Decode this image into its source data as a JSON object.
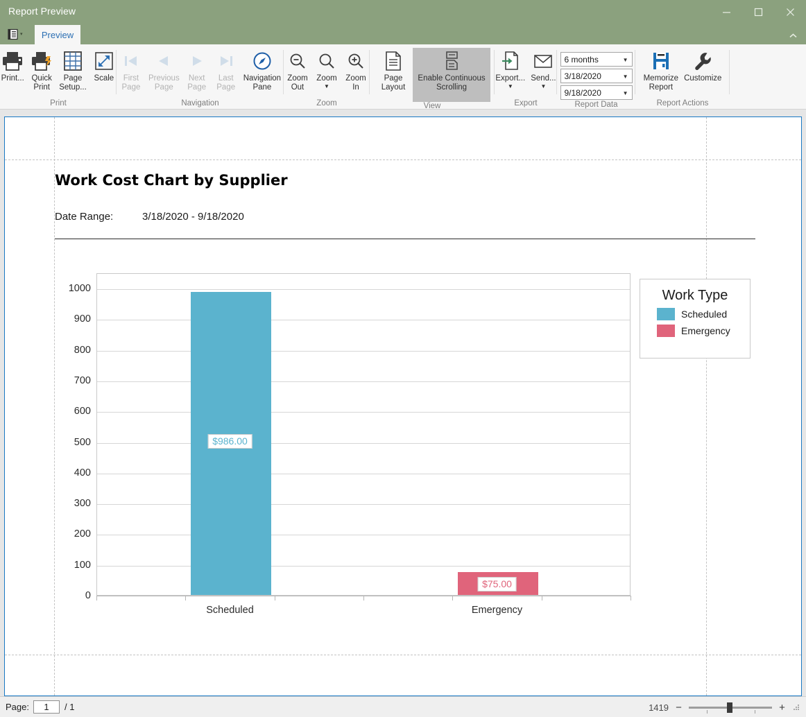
{
  "window": {
    "title": "Report Preview",
    "minimize_label": "Minimize",
    "maximize_label": "Maximize",
    "close_label": "Close"
  },
  "tabs": {
    "quick_access_icon": "report-icon",
    "items": [
      {
        "label": "Preview",
        "active": true
      }
    ],
    "collapse_icon": "chevron-up-icon"
  },
  "ribbon": {
    "groups": [
      {
        "name": "Print",
        "label": "Print",
        "buttons": [
          {
            "name": "print",
            "label": "Print...",
            "icon": "printer-icon",
            "disabled": false,
            "caret": false
          },
          {
            "name": "quick-print",
            "label": "Quick\nPrint",
            "icon": "quick-printer-icon",
            "disabled": false,
            "caret": false
          },
          {
            "name": "page-setup",
            "label": "Page\nSetup...",
            "icon": "page-setup-icon",
            "disabled": false,
            "caret": false
          },
          {
            "name": "scale",
            "label": "Scale",
            "icon": "scale-icon",
            "disabled": false,
            "caret": false
          }
        ]
      },
      {
        "name": "Navigation",
        "label": "Navigation",
        "buttons": [
          {
            "name": "first-page",
            "label": "First\nPage",
            "icon": "first-page-icon",
            "disabled": true,
            "caret": false
          },
          {
            "name": "previous-page",
            "label": "Previous\nPage",
            "icon": "previous-page-icon",
            "disabled": true,
            "caret": false
          },
          {
            "name": "next-page",
            "label": "Next\nPage",
            "icon": "next-page-icon",
            "disabled": true,
            "caret": false
          },
          {
            "name": "last-page",
            "label": "Last\nPage",
            "icon": "last-page-icon",
            "disabled": true,
            "caret": false
          },
          {
            "name": "navigation-pane",
            "label": "Navigation\nPane",
            "icon": "compass-icon",
            "disabled": false,
            "caret": false
          }
        ]
      },
      {
        "name": "Zoom",
        "label": "Zoom",
        "buttons": [
          {
            "name": "zoom-out",
            "label": "Zoom\nOut",
            "icon": "zoom-out-icon",
            "disabled": false,
            "caret": false
          },
          {
            "name": "zoom",
            "label": "Zoom",
            "icon": "magnifier-icon",
            "disabled": false,
            "caret": true
          },
          {
            "name": "zoom-in",
            "label": "Zoom\nIn",
            "icon": "zoom-in-icon",
            "disabled": false,
            "caret": false
          }
        ]
      },
      {
        "name": "View",
        "label": "View",
        "buttons": [
          {
            "name": "page-layout",
            "label": "Page\nLayout",
            "icon": "page-layout-icon",
            "disabled": false,
            "caret": "inline"
          },
          {
            "name": "enable-continuous-scrolling",
            "label": "Enable Continuous\nScrolling",
            "icon": "continuous-scrolling-icon",
            "disabled": false,
            "caret": false,
            "toggled": true
          }
        ]
      },
      {
        "name": "Export",
        "label": "Export",
        "buttons": [
          {
            "name": "export",
            "label": "Export...",
            "icon": "export-icon",
            "disabled": false,
            "caret": true
          },
          {
            "name": "send",
            "label": "Send...",
            "icon": "envelope-icon",
            "disabled": false,
            "caret": true
          }
        ]
      },
      {
        "name": "Report Data",
        "label": "Report Data",
        "combos": [
          {
            "name": "date-range-preset",
            "value": "6 months"
          },
          {
            "name": "date-from",
            "value": "3/18/2020"
          },
          {
            "name": "date-to",
            "value": "9/18/2020"
          }
        ]
      },
      {
        "name": "Report Actions",
        "label": "Report Actions",
        "buttons": [
          {
            "name": "memorize-report",
            "label": "Memorize\nReport",
            "icon": "floppy-disk-icon",
            "disabled": false,
            "caret": false
          },
          {
            "name": "customize",
            "label": "Customize",
            "icon": "wrench-icon",
            "disabled": false,
            "caret": false
          }
        ]
      }
    ]
  },
  "report": {
    "title": "Work Cost Chart by Supplier",
    "date_range_label": "Date Range:",
    "date_range_value": "3/18/2020  -  9/18/2020"
  },
  "chart_data": {
    "type": "bar",
    "title": "Work Cost Chart by Supplier",
    "categories": [
      "Scheduled",
      "Emergency"
    ],
    "values": [
      986,
      75
    ],
    "data_labels": [
      "$986.00",
      "$75.00"
    ],
    "series": [
      {
        "name": "Scheduled",
        "values": [
          986,
          null
        ],
        "color": "#5BB3CE"
      },
      {
        "name": "Emergency",
        "values": [
          null,
          75
        ],
        "color": "#E0647B"
      }
    ],
    "xlabel": "",
    "ylabel": "",
    "ylim": [
      0,
      1050
    ],
    "yticks": [
      0,
      100,
      200,
      300,
      400,
      500,
      600,
      700,
      800,
      900,
      1000
    ],
    "ytick_labels": [
      "0",
      "100",
      "200",
      "300",
      "400",
      "500",
      "600",
      "700",
      "800",
      "900",
      "1000"
    ],
    "grid": true,
    "legend": {
      "position": "right",
      "title": "Work Type",
      "entries": [
        {
          "label": "Scheduled",
          "color": "#5BB3CE"
        },
        {
          "label": "Emergency",
          "color": "#E0647B"
        }
      ]
    }
  },
  "statusbar": {
    "page_label": "Page:",
    "page_value": "1",
    "page_total": "/ 1",
    "zoom_value": "1419",
    "zoom_out_label": "−",
    "zoom_in_label": "+"
  }
}
